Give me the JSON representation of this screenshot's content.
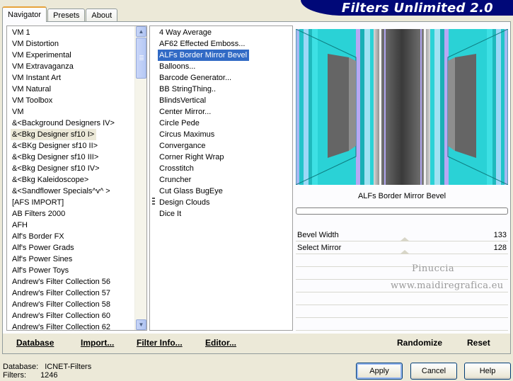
{
  "tabs": [
    "Navigator",
    "Presets",
    "About"
  ],
  "app_title": "Filters Unlimited 2.0",
  "categories": [
    "VM 1",
    "VM Distortion",
    "VM Experimental",
    "VM Extravaganza",
    "VM Instant Art",
    "VM Natural",
    "VM Toolbox",
    "VM",
    "&<Background Designers IV>",
    "&<Bkg Designer sf10 I>",
    "&<BKg Designer sf10 II>",
    "&<Bkg Designer sf10 III>",
    "&<Bkg Designer sf10 IV>",
    "&<Bkg Kaleidoscope>",
    "&<Sandflower Specials^v^ >",
    "[AFS IMPORT]",
    "AB Filters 2000",
    "AFH",
    "Alf's Border FX",
    "Alf's Power Grads",
    "Alf's Power Sines",
    "Alf's Power Toys",
    "Andrew's Filter Collection 56",
    "Andrew's Filter Collection 57",
    "Andrew's Filter Collection 58",
    "Andrew's Filter Collection 60",
    "Andrew's Filter Collection 62"
  ],
  "selected_category": "&<Bkg Designer sf10 I>",
  "filters": [
    "4 Way Average",
    "AF62 Effected Emboss...",
    "ALFs Border Mirror Bevel",
    "Balloons...",
    "Barcode Generator...",
    "BB StringThing..",
    "BlindsVertical",
    "Center Mirror...",
    "Circle Pede",
    "Circus Maximus",
    "Convergance",
    "Corner Right Wrap",
    "Crosstitch",
    "Cruncher",
    "Cut Glass  BugEye",
    "Design Clouds",
    "Dice It"
  ],
  "selected_filter": "ALFs Border Mirror Bevel",
  "filter_name": "ALFs Border Mirror Bevel",
  "progress": 0,
  "params": [
    {
      "label": "Bevel Width",
      "value": "133"
    },
    {
      "label": "Select Mirror",
      "value": "128"
    }
  ],
  "watermark": [
    "Pinuccia",
    "www.maidiregrafica.eu"
  ],
  "bottom_buttons": {
    "database": "Database",
    "import": "Import...",
    "filter_info": "Filter Info...",
    "editor": "Editor...",
    "randomize": "Randomize",
    "reset": "Reset"
  },
  "status": {
    "database_label": "Database:",
    "database_value": "ICNET-Filters",
    "filters_label": "Filters:",
    "filters_value": "1246"
  },
  "dialog_buttons": {
    "apply": "Apply",
    "cancel": "Cancel",
    "help": "Help"
  },
  "colors": {
    "banner": "#000878",
    "selection": "#316ac5",
    "preview_cyan": "#29d1d5"
  }
}
